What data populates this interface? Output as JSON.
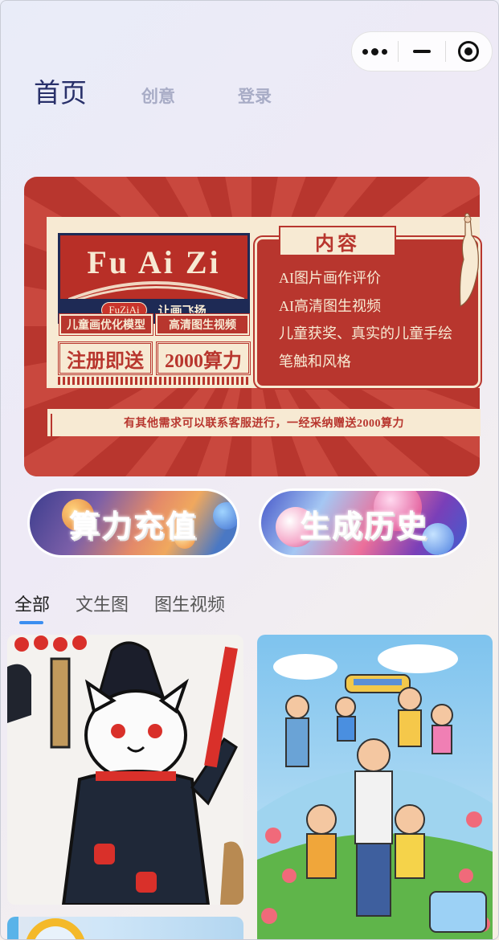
{
  "capsule": {
    "more_icon": "more-dots-icon",
    "minimize_icon": "minus-icon",
    "close_icon": "target-circle-icon"
  },
  "topnav": {
    "home": "首页",
    "creative": "创意",
    "login": "登录"
  },
  "banner": {
    "logo_title": "Fu Ai Zi",
    "logo_badge": "FuZiAi",
    "logo_slogan": "让画飞扬",
    "tag_model": "儿童画优化模型",
    "tag_video": "高清图生视频",
    "promo_left": "注册即送",
    "promo_right": "2000算力",
    "content_title": "内容",
    "content_lines": [
      "AI图片画作评价",
      "AI高清图生视频",
      "儿童获奖、真实的儿童手绘",
      "笔触和风格"
    ],
    "note": "有其他需求可以联系客服进行，一经采纳赠送2000算力",
    "colors": {
      "red": "#b8362e",
      "cream": "#f7ead3",
      "navy": "#1e2a55"
    }
  },
  "actions": {
    "recharge": "算力充值",
    "history": "生成历史"
  },
  "tabs": [
    "全部",
    "文生图",
    "图生视频"
  ],
  "active_tab": "全部",
  "accent": "#3b8ef0",
  "gallery": [
    {
      "subject": "cat-drawing-image"
    },
    {
      "subject": "family-outing-drawing-image"
    },
    {
      "subject": "sky-drawing-image"
    }
  ]
}
